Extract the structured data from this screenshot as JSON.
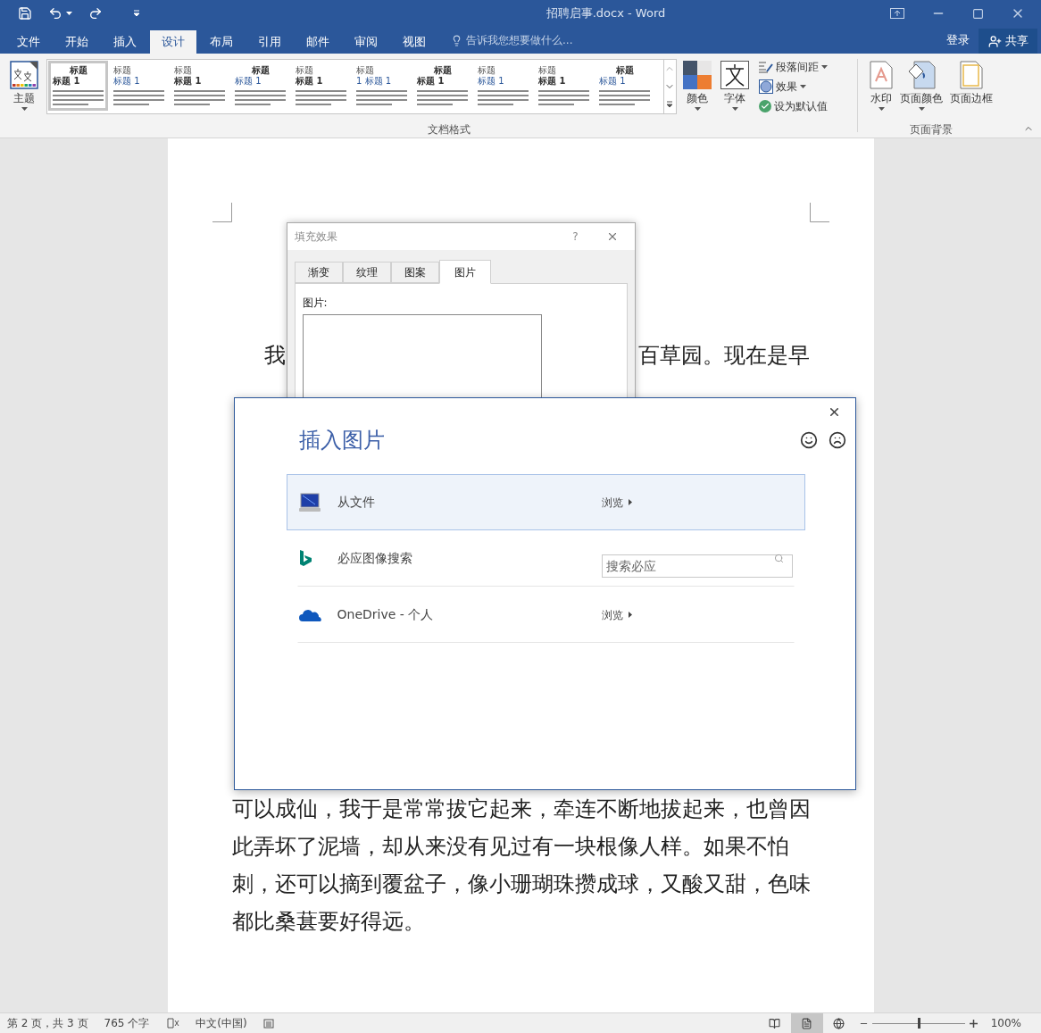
{
  "window": {
    "title": "招聘启事.docx - Word"
  },
  "tabs": [
    {
      "label": "文件",
      "selected": false
    },
    {
      "label": "开始",
      "selected": false
    },
    {
      "label": "插入",
      "selected": false
    },
    {
      "label": "设计",
      "selected": true
    },
    {
      "label": "布局",
      "selected": false
    },
    {
      "label": "引用",
      "selected": false
    },
    {
      "label": "邮件",
      "selected": false
    },
    {
      "label": "审阅",
      "selected": false
    },
    {
      "label": "视图",
      "selected": false
    }
  ],
  "tell_me": {
    "placeholder": "告诉我您想要做什么..."
  },
  "account": {
    "sign_in": "登录",
    "share": "共享"
  },
  "ribbon": {
    "themes": "主题",
    "style_gallery": [
      {
        "heading": "标题",
        "subheading": "标题 1",
        "selected": true
      },
      {
        "heading": "标题",
        "subheading": "标题 1",
        "selected": false
      },
      {
        "heading": "标题",
        "subheading": "标题 1",
        "selected": false
      },
      {
        "heading": "标题",
        "subheading": "标题 1",
        "selected": false
      },
      {
        "heading": "标题",
        "subheading": "标题 1",
        "selected": false
      },
      {
        "heading": "标题",
        "subheading": "1 标题 1",
        "selected": false
      },
      {
        "heading": "标题",
        "subheading": "标题 1",
        "selected": false
      },
      {
        "heading": "标题",
        "subheading": "标题 1",
        "selected": false
      },
      {
        "heading": "标题",
        "subheading": "标题 1",
        "selected": false
      },
      {
        "heading": "标题",
        "subheading": "标题 1",
        "selected": false
      }
    ],
    "colors": "颜色",
    "fonts": "字体",
    "paragraph_spacing": "段落间距",
    "effects": "效果",
    "set_default": "设为默认值",
    "document_formatting_group": "文档格式",
    "watermark": "水印",
    "page_color": "页面颜色",
    "page_borders": "页面边框",
    "page_background_group": "页面背景"
  },
  "document": {
    "top_lines": [
      {
        "start": "我",
        "end": "百草园。现在是早"
      }
    ],
    "bottom_lines": [
      "可以成仙，我于是常常拔它起来，牵连不断地拔起来，也曾因",
      "此弄坏了泥墙，却从来没有见过有一块根像人样。如果不怕",
      "刺，还可以摘到覆盆子，像小珊瑚珠攒成球，又酸又甜，色味",
      "都比桑葚要好得远。"
    ]
  },
  "fill_dialog": {
    "title": "填充效果",
    "help": "?",
    "tabs": [
      {
        "label": "渐变",
        "selected": false
      },
      {
        "label": "纹理",
        "selected": false
      },
      {
        "label": "图案",
        "selected": false
      },
      {
        "label": "图片",
        "selected": true
      }
    ],
    "picture_label": "图片:"
  },
  "insert_dialog": {
    "title": "插入图片",
    "sources": [
      {
        "kind": "browse",
        "label": "从文件",
        "action": "浏览",
        "selected": true
      },
      {
        "kind": "search",
        "label": "必应图像搜索",
        "placeholder": "搜索必应",
        "selected": false
      },
      {
        "kind": "browse",
        "label": "OneDrive - 个人",
        "action": "浏览",
        "selected": false
      }
    ]
  },
  "status_bar": {
    "page": "第 2 页，共 3 页",
    "words": "765 个字",
    "language": "中文(中国)",
    "views": [
      {
        "selected": false
      },
      {
        "selected": true
      },
      {
        "selected": false
      }
    ],
    "zoom": {
      "level": 0.5,
      "reading": "100%"
    }
  }
}
